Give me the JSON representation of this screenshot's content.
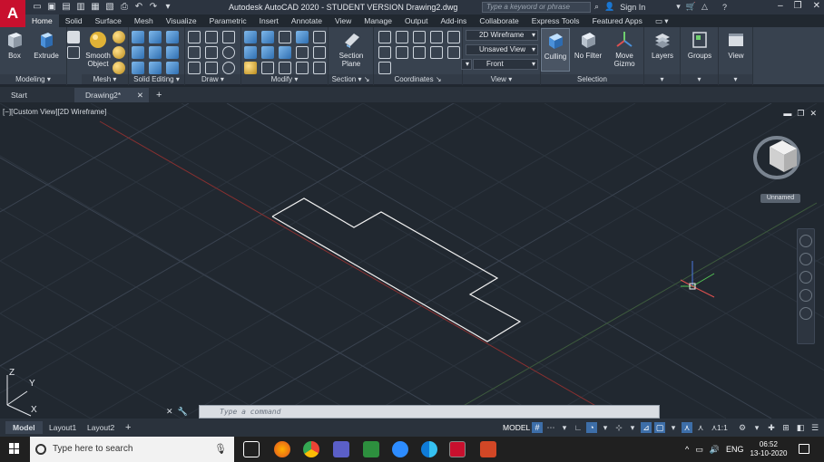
{
  "app": {
    "logo_letter": "A",
    "title": "Autodesk AutoCAD 2020 - STUDENT VERSION    Drawing2.dwg",
    "search_placeholder": "Type a keyword or phrase",
    "sign_in": "Sign In"
  },
  "ribbon_tabs": [
    "Home",
    "Solid",
    "Surface",
    "Mesh",
    "Visualize",
    "Parametric",
    "Insert",
    "Annotate",
    "View",
    "Manage",
    "Output",
    "Add-ins",
    "Collaborate",
    "Express Tools",
    "Featured Apps"
  ],
  "ribbon": {
    "modeling": {
      "title": "Modeling",
      "box": "Box",
      "extrude": "Extrude"
    },
    "mesh": {
      "title": "Mesh",
      "smooth_object": "Smooth Object"
    },
    "solid_editing": {
      "title": "Solid Editing"
    },
    "draw": {
      "title": "Draw"
    },
    "modify": {
      "title": "Modify"
    },
    "section": {
      "title": "Section",
      "section_plane": "Section Plane"
    },
    "coordinates": {
      "title": "Coordinates"
    },
    "view": {
      "title": "View",
      "visual_style": "2D Wireframe",
      "saved_view": "Unsaved View",
      "named_view": "Front"
    },
    "selection": {
      "title": "Selection",
      "culling": "Culling",
      "no_filter": "No Filter",
      "move_gizmo": "Move Gizmo"
    },
    "layers": {
      "title": "Layers"
    },
    "groups": {
      "title": "Groups"
    },
    "view_panel": {
      "title": "View"
    }
  },
  "doc_tabs": {
    "start": "Start",
    "drawing": "Drawing2*",
    "close": "✕",
    "add": "+"
  },
  "viewport": {
    "label": "[−][Custom View][2D Wireframe]",
    "unnamed": "Unnamed",
    "ucs_z": "Z",
    "ucs_y": "Y",
    "ucs_x": "X"
  },
  "command_line": {
    "placeholder": "Type a command"
  },
  "layout_tabs": [
    "Model",
    "Layout1",
    "Layout2"
  ],
  "status": {
    "model": "MODEL",
    "scale": "1:1"
  },
  "taskbar": {
    "search_placeholder": "Type here to search",
    "language": "ENG",
    "time": "06:52",
    "date": "13-10-2020"
  },
  "colors": {
    "accent": "#3d6ea8",
    "brand": "#c8102e",
    "viewport_bg": "#212830"
  }
}
